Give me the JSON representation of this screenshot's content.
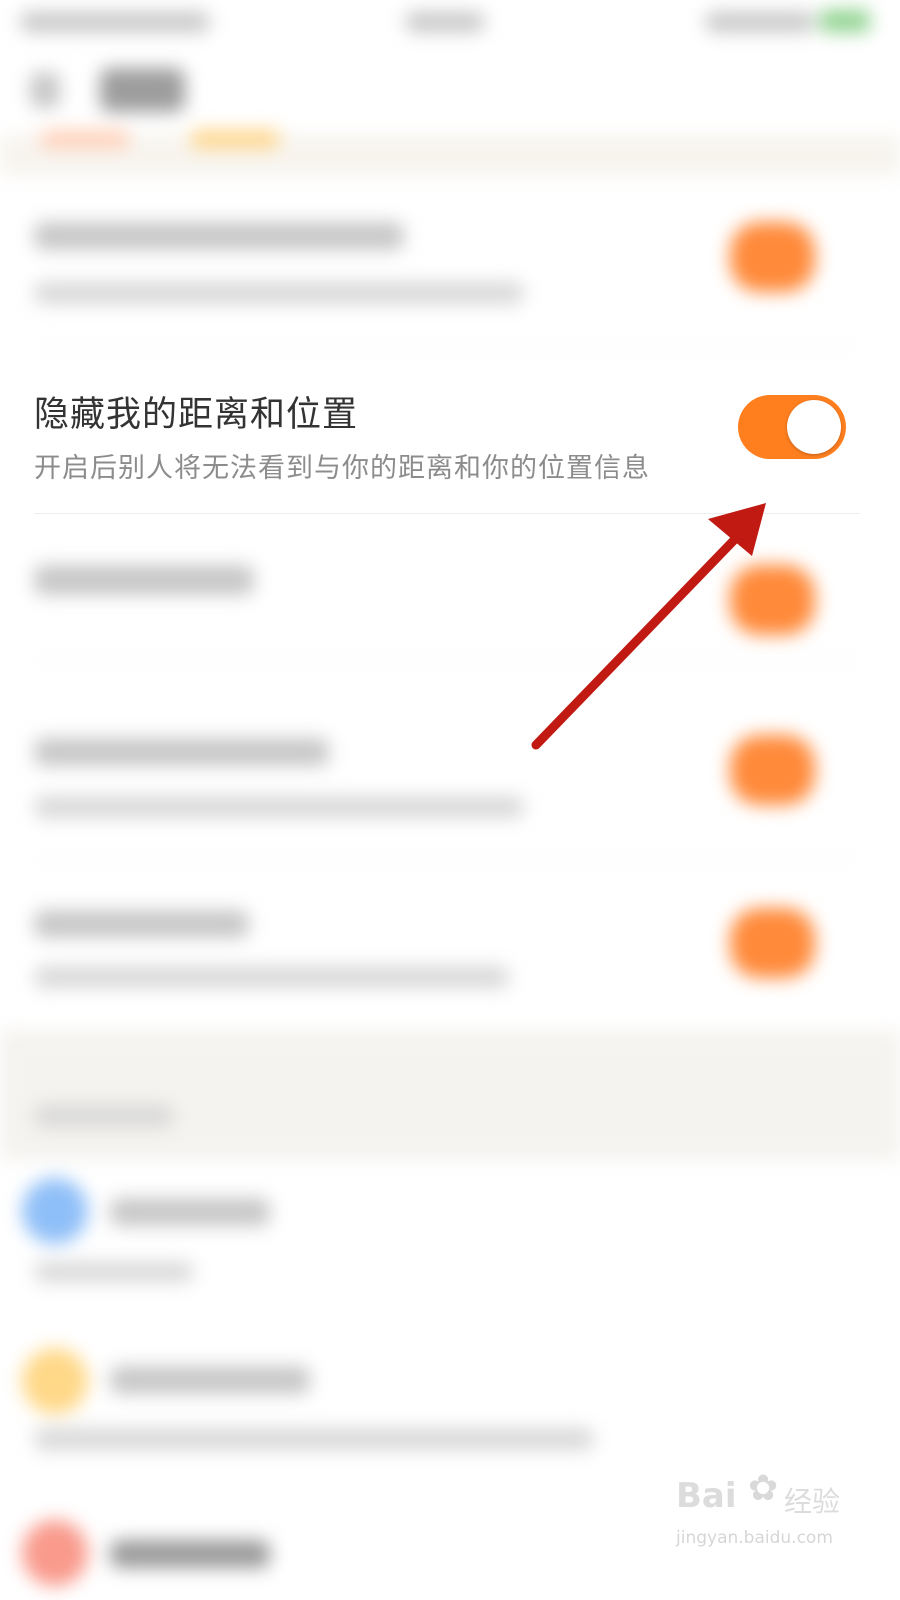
{
  "setting": {
    "title": "隐藏我的距离和位置",
    "description": "开启后别人将无法看到与你的距离和你的位置信息",
    "enabled": true
  },
  "colors": {
    "toggle_on": "#ff7f1f",
    "arrow": "#c01a12"
  },
  "watermark": {
    "brand_prefix": "Bai",
    "brand_suffix": "经验",
    "url": "jingyan.baidu.com"
  }
}
